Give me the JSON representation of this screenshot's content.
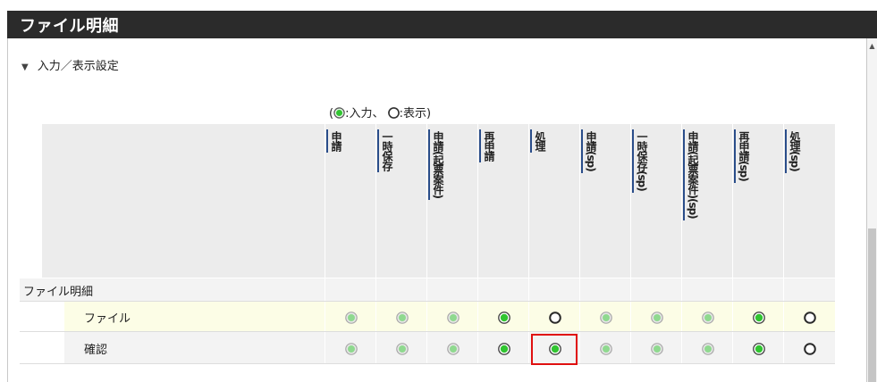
{
  "header": {
    "title": "ファイル明細"
  },
  "section": {
    "toggle_icon": "caret-down-icon",
    "title": "入力／表示設定"
  },
  "legend": {
    "open": "(",
    "input_label": ":入力、",
    "display_label": ":表示)"
  },
  "columns": [
    "申請",
    "一時保存",
    "申請(起票案件)",
    "再申請",
    "処理",
    "申請(sp)",
    "一時保存(sp)",
    "申請(起票案件)(sp)",
    "再申請(sp)",
    "処理(sp)"
  ],
  "rows": [
    {
      "label": "ファイル明細",
      "type": "group"
    },
    {
      "label": "ファイル",
      "type": "item",
      "states": [
        "input-disabled",
        "input-disabled",
        "input-disabled",
        "input",
        "display",
        "input-disabled",
        "input-disabled",
        "input-disabled",
        "input",
        "display"
      ]
    },
    {
      "label": "確認",
      "type": "item",
      "states": [
        "input-disabled",
        "input-disabled",
        "input-disabled",
        "input",
        "input",
        "input-disabled",
        "input-disabled",
        "input-disabled",
        "input",
        "display"
      ]
    }
  ],
  "highlighted_cell": {
    "row": "確認",
    "column": "処理"
  },
  "colors": {
    "header_bg": "#2b2b2b",
    "column_bar": "#2a4d8a",
    "highlight": "#e01010",
    "file_row_bg": "#fcfde6",
    "radio_green": "#31c531"
  }
}
